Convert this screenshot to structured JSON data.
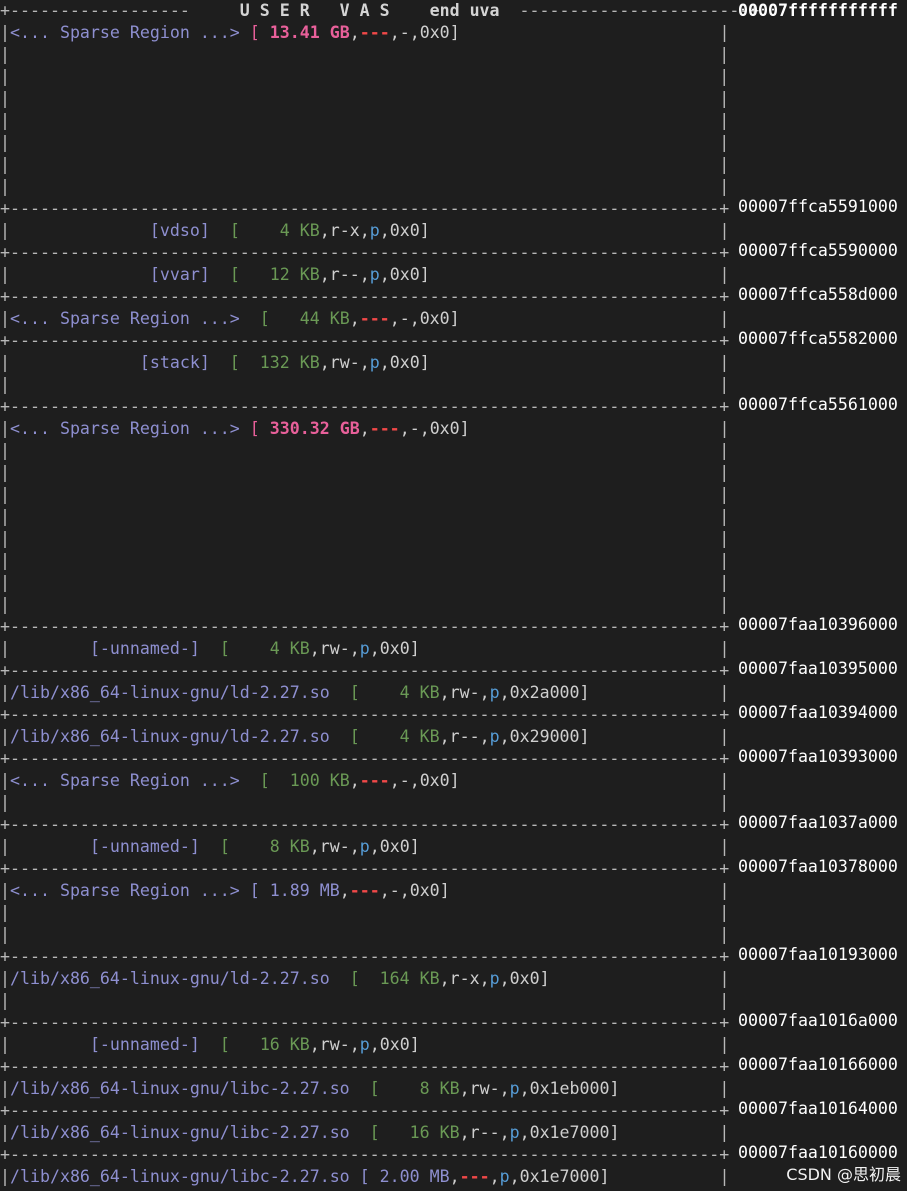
{
  "header": {
    "title": "U S E R   V A S",
    "end_label": "end uva",
    "top_address": "00007fffffffffff"
  },
  "regions": [
    {
      "addr": "00007ffca5591000",
      "name": "<... Sparse Region ...>",
      "size": "13.41 GB",
      "perm": "---",
      "mapped": "-",
      "offset": "0x0",
      "style": "sparse-hot",
      "height_lines": 8
    },
    {
      "addr": "00007ffca5590000",
      "name": "[vdso]",
      "size": "4 KB",
      "perm": "r-x",
      "mapped": "p",
      "offset": "0x0",
      "style": "named",
      "height_lines": 1
    },
    {
      "addr": "00007ffca558d000",
      "name": "[vvar]",
      "size": "12 KB",
      "perm": "r--",
      "mapped": "p",
      "offset": "0x0",
      "style": "named",
      "height_lines": 1
    },
    {
      "addr": "00007ffca5582000",
      "name": "<... Sparse Region ...>",
      "size": "44 KB",
      "perm": "---",
      "mapped": "-",
      "offset": "0x0",
      "style": "sparse-kb",
      "height_lines": 1
    },
    {
      "addr": "00007ffca5561000",
      "name": "[stack]",
      "size": "132 KB",
      "perm": "rw-",
      "mapped": "p",
      "offset": "0x0",
      "style": "named",
      "height_lines": 2
    },
    {
      "addr": "00007faa10396000",
      "name": "<... Sparse Region ...>",
      "size": "330.32 GB",
      "perm": "---",
      "mapped": "-",
      "offset": "0x0",
      "style": "sparse-hot",
      "height_lines": 9
    },
    {
      "addr": "00007faa10395000",
      "name": "[-unnamed-]",
      "size": "4 KB",
      "perm": "rw-",
      "mapped": "p",
      "offset": "0x0",
      "style": "named",
      "height_lines": 1
    },
    {
      "addr": "00007faa10394000",
      "name": "/lib/x86_64-linux-gnu/ld-2.27.so",
      "size": "4 KB",
      "perm": "rw-",
      "mapped": "p",
      "offset": "0x2a000",
      "style": "file",
      "height_lines": 1
    },
    {
      "addr": "00007faa10393000",
      "name": "/lib/x86_64-linux-gnu/ld-2.27.so",
      "size": "4 KB",
      "perm": "r--",
      "mapped": "p",
      "offset": "0x29000",
      "style": "file",
      "height_lines": 1
    },
    {
      "addr": "00007faa1037a000",
      "name": "<... Sparse Region ...>",
      "size": "100 KB",
      "perm": "---",
      "mapped": "-",
      "offset": "0x0",
      "style": "sparse-kb",
      "height_lines": 2
    },
    {
      "addr": "00007faa10378000",
      "name": "[-unnamed-]",
      "size": "8 KB",
      "perm": "rw-",
      "mapped": "p",
      "offset": "0x0",
      "style": "named",
      "height_lines": 1
    },
    {
      "addr": "00007faa10193000",
      "name": "<... Sparse Region ...>",
      "size": "1.89 MB",
      "perm": "---",
      "mapped": "-",
      "offset": "0x0",
      "style": "sparse-mb",
      "height_lines": 3
    },
    {
      "addr": "00007faa1016a000",
      "name": "/lib/x86_64-linux-gnu/ld-2.27.so",
      "size": "164 KB",
      "perm": "r-x",
      "mapped": "p",
      "offset": "0x0",
      "style": "file",
      "height_lines": 2
    },
    {
      "addr": "00007faa10166000",
      "name": "[-unnamed-]",
      "size": "16 KB",
      "perm": "rw-",
      "mapped": "p",
      "offset": "0x0",
      "style": "named",
      "height_lines": 1
    },
    {
      "addr": "00007faa10164000",
      "name": "/lib/x86_64-linux-gnu/libc-2.27.so",
      "size": "8 KB",
      "perm": "rw-",
      "mapped": "p",
      "offset": "0x1eb000",
      "style": "file",
      "height_lines": 1
    },
    {
      "addr": "00007faa10160000",
      "name": "/lib/x86_64-linux-gnu/libc-2.27.so",
      "size": "16 KB",
      "perm": "r--",
      "mapped": "p",
      "offset": "0x1e7000",
      "style": "file",
      "height_lines": 1
    },
    {
      "addr": "",
      "name": "/lib/x86_64-linux-gnu/libc-2.27.so",
      "size": "2.00 MB",
      "perm": "---",
      "mapped": "p",
      "offset": "0x1e7000",
      "style": "file-mb",
      "height_lines": 1
    }
  ],
  "watermark": "CSDN @思初晨"
}
